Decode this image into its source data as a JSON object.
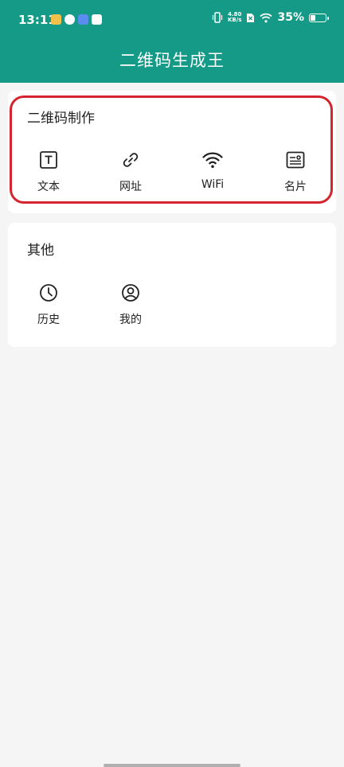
{
  "status_bar": {
    "time": "13:11",
    "net_speed_value": "4.80",
    "net_speed_unit": "KB/s",
    "battery_percent": "35%",
    "notification_icons": [
      "weibo-icon",
      "app-icon",
      "baidu-icon",
      "message-icon"
    ]
  },
  "header": {
    "title": "二维码生成王",
    "color": "#159a87"
  },
  "sections": {
    "make": {
      "title": "二维码制作",
      "items": [
        {
          "label": "文本",
          "icon": "text-icon"
        },
        {
          "label": "网址",
          "icon": "link-icon"
        },
        {
          "label": "WiFi",
          "icon": "wifi-icon"
        },
        {
          "label": "名片",
          "icon": "card-icon"
        }
      ]
    },
    "other": {
      "title": "其他",
      "items": [
        {
          "label": "历史",
          "icon": "clock-icon"
        },
        {
          "label": "我的",
          "icon": "user-icon"
        }
      ]
    }
  },
  "annotation": {
    "highlight_color": "#d4242f"
  }
}
